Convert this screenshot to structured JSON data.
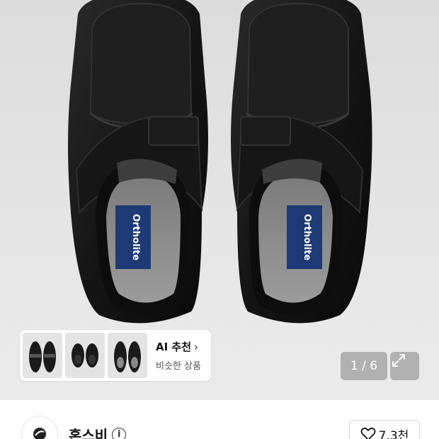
{
  "product_image": {
    "alt": "black leather shoes with velcro strap",
    "insole_brand": "Ortholite"
  },
  "ai_recommend": {
    "title": "AI 추천",
    "chevron_icon": "chevron-right-icon",
    "subtitle": "비슷한 상품"
  },
  "gallery": {
    "counter": "1 / 6",
    "expand_icon": "expand-icon"
  },
  "seller": {
    "name": "혼스비",
    "info_icon": "i",
    "like_icon": "heart-icon",
    "like_count": "7.3천"
  }
}
